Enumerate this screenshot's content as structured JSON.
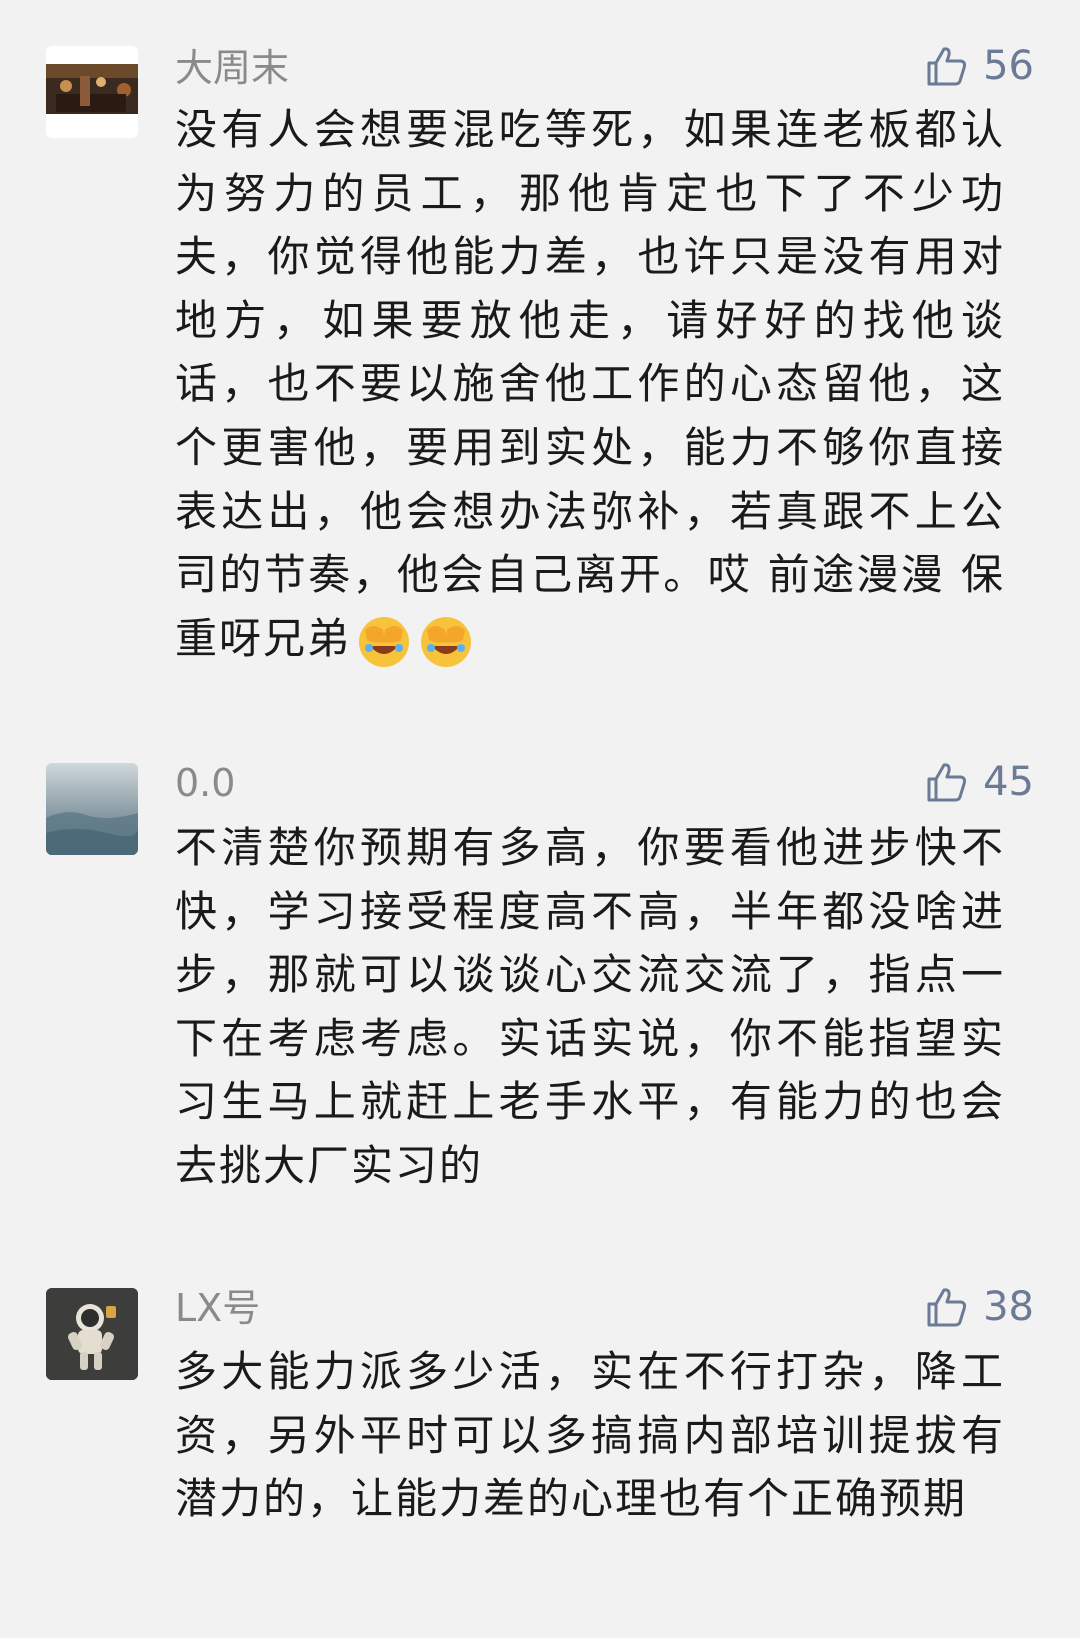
{
  "comments": [
    {
      "username": "大周末",
      "likes": "56",
      "text": "没有人会想要混吃等死，如果连老板都认为努力的员工，那他肯定也下了不少功夫，你觉得他能力差，也许只是没有用对地方，如果要放他走，请好好的找他谈话，也不要以施舍他工作的心态留他，这个更害他，要用到实处，能力不够你直接表达出，他会想办法弥补，若真跟不上公司的节奏，他会自己离开。哎 前途漫漫 保重呀兄弟",
      "emojis": [
        "facepalm-emoji",
        "facepalm-emoji"
      ]
    },
    {
      "username": "0.0",
      "likes": "45",
      "text": "不清楚你预期有多高，你要看他进步快不快，学习接受程度高不高，半年都没啥进步，那就可以谈谈心交流交流了，指点一下在考虑考虑。实话实说，你不能指望实习生马上就赶上老手水平，有能力的也会去挑大厂实习的"
    },
    {
      "username": "LX号",
      "likes": "38",
      "text": "多大能力派多少活，实在不行打杂，降工资，另外平时可以多搞搞内部培训提拔有潜力的，让能力差的心理也有个正确预期"
    }
  ],
  "icons": {
    "like": "thumbs-up-icon",
    "like_color": "#6b7a95"
  }
}
